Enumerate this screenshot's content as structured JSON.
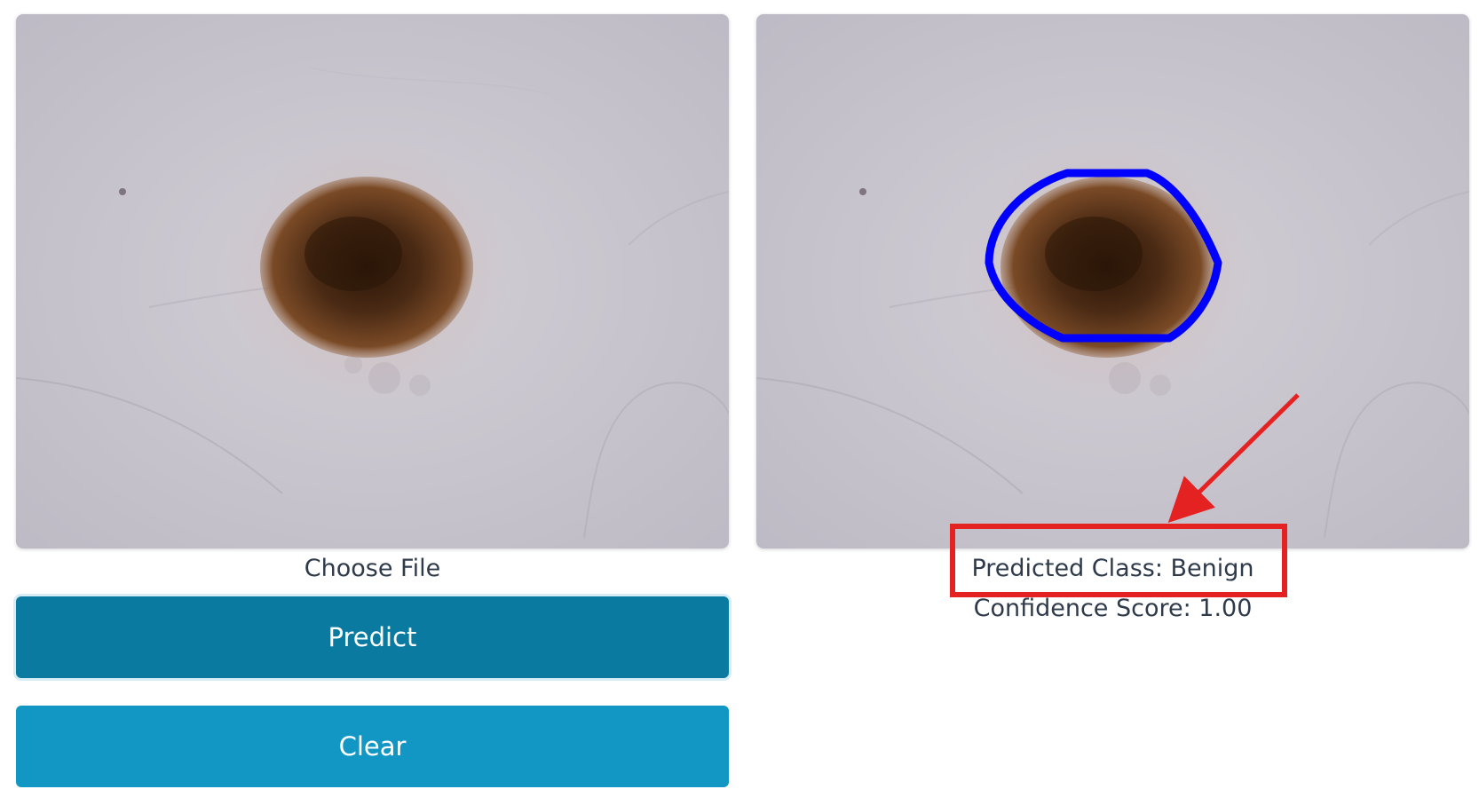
{
  "upload": {
    "choose_file_label": "Choose File"
  },
  "buttons": {
    "predict_label": "Predict",
    "clear_label": "Clear"
  },
  "result": {
    "predicted_class": "Predicted Class: Benign",
    "confidence_score": "Confidence Score: 1.00"
  },
  "colors": {
    "predict_button": "#0a7aa0",
    "clear_button": "#1297c4",
    "contour": "#0000ff",
    "highlight_box": "#e52222",
    "skin_background": "#c9c6cf",
    "lesion": "#4a2a14"
  }
}
